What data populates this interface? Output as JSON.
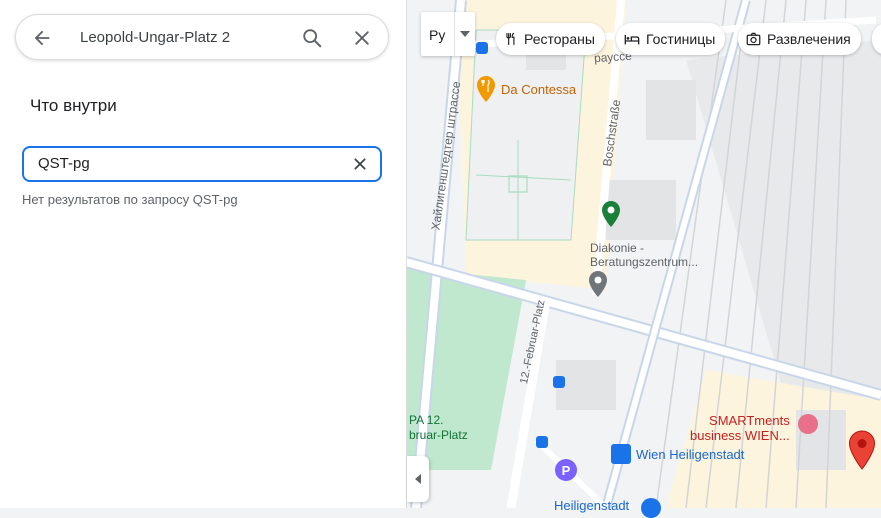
{
  "search": {
    "query": "Leopold-Ungar-Platz 2"
  },
  "panel": {
    "inside_title": "Что внутри",
    "filter_value": "QST-pg",
    "no_results": "Нет результатов по запросу QST-pg"
  },
  "map": {
    "layer_lang": "Ру",
    "chips": [
      "Рестораны",
      "Гостиницы",
      "Развлечения"
    ],
    "streets": {
      "heiligenstaedter": "Хайлигенштедтер штрассе",
      "strasse_top": "рауссе",
      "boschstrasse": "Boschstraße",
      "februar_platz": "12.-Februar-Platz"
    },
    "places": {
      "da_contessa": "Da Contessa",
      "diakonie_1": "Diakonie -",
      "diakonie_2": "Beratungszentrum...",
      "smartments_1": "SMARTments",
      "smartments_2": "business WIEN...",
      "wien_heiligenstadt": "Wien Heiligenstadt",
      "heiligenstadt_bottom": "Heiligenstadt",
      "pa12_1": "PA 12.",
      "pa12_2": "bruar-Platz"
    },
    "colors": {
      "road": "#ffffff",
      "road_major": "#c8d6ea",
      "park": "#bfe8cf",
      "building": "#e8e9eb",
      "block": "#fdf4dd",
      "transit": "#1a73e8",
      "pin": "#ea4335",
      "food": "#f29900",
      "hotel": "#e8708a",
      "service": "#188038"
    }
  }
}
